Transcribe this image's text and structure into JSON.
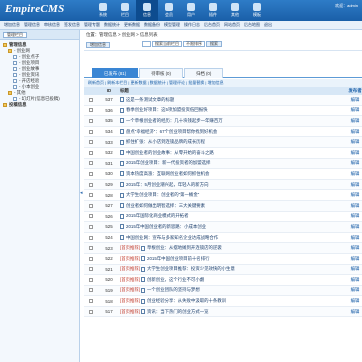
{
  "header": {
    "logo_main": "EmpireCMS",
    "logo_sub": "",
    "nav": [
      "系统",
      "栏目",
      "信息",
      "会员",
      "用户",
      "插件",
      "其他",
      "模板"
    ],
    "active_nav": 2,
    "welcome": "欢迎：admin"
  },
  "subnav": [
    "增加信息",
    "管理信息",
    "审核信息",
    "签发信息",
    "管理专题",
    "数据统计",
    "更新数据",
    "数据备份",
    "模型管理",
    "操作日志",
    "后台首页",
    "网站首页",
    "后台地图",
    "退出"
  ],
  "sidebar": {
    "top_button": "管理栏目",
    "tree": [
      {
        "label": "管理信息",
        "level": 1,
        "folder": true
      },
      {
        "label": "- 创业网",
        "level": 2,
        "folder": true
      },
      {
        "label": "- 创业点子",
        "level": 3,
        "folder": false
      },
      {
        "label": "- 创业项目",
        "level": 3,
        "folder": false
      },
      {
        "label": "- 创业故事",
        "level": 3,
        "folder": false
      },
      {
        "label": "- 创业资讯",
        "level": 3,
        "folder": false
      },
      {
        "label": "- 开店经验",
        "level": 3,
        "folder": false
      },
      {
        "label": "- 小本创业",
        "level": 3,
        "folder": false
      },
      {
        "label": "- 其他",
        "level": 2,
        "folder": true
      },
      {
        "label": "- 幻灯片(信息已投稿)",
        "level": 3,
        "folder": false
      },
      {
        "label": "投稿信息",
        "level": 1,
        "folder": true
      }
    ]
  },
  "main": {
    "breadcrumb": "位置：管理信息 > 创业网 > 信息列表",
    "toolbar_button": "增加信息",
    "search": {
      "select1": "搜索当前栏目",
      "select2": "不限排序",
      "go": "搜索"
    },
    "tabs": [
      "已发布 (81)",
      "待审核 (0)",
      "归档 (0)"
    ],
    "active_tab": 0,
    "filter_text": "刷新首页 | 刷新本栏目 | 更新数据 | 数据统计 | 管理评论 | 批量替换 | 增加信息",
    "columns": [
      "",
      "ID",
      "标题",
      "发布者"
    ],
    "rows": [
      {
        "id": "537",
        "tag": "",
        "title": "这是一条测试文章的标题"
      },
      {
        "id": "536",
        "tag": "",
        "title": "春季创业好项目：这5项加盟投资低回报快"
      },
      {
        "id": "535",
        "tag": "",
        "title": "一个草根创业者的经历：几十块钱起步一年赚百万"
      },
      {
        "id": "534",
        "tag": "",
        "title": "盘点“幸福经济”：67个创业项目帮你找到好机会"
      },
      {
        "id": "533",
        "tag": "",
        "title": "抓住扩张：从小店到连锁品牌的成长历程"
      },
      {
        "id": "532",
        "tag": "",
        "title": "中国创业者的创业故事：从零开始的奋斗之路"
      },
      {
        "id": "531",
        "tag": "",
        "title": "2015年创业项目：新一代投资者的加盟选择"
      },
      {
        "id": "530",
        "tag": "",
        "title": "资本热度高涨：互联网创业者如何抓住机会"
      },
      {
        "id": "529",
        "tag": "",
        "title": "2015年：5月创业潮兴起，年轻人的新方向"
      },
      {
        "id": "528",
        "tag": "",
        "title": "大学生创业项目：创业者的“第一桶金”"
      },
      {
        "id": "527",
        "tag": "",
        "title": "创业者如何做出明智选择：三大关键要素"
      },
      {
        "id": "526",
        "tag": "",
        "title": "2015年国际化商业模式的开拓者"
      },
      {
        "id": "525",
        "tag": "",
        "title": "2015年中国创业者的新思路：小成本创业"
      },
      {
        "id": "524",
        "tag": "",
        "title": "中国创业网：宣布与多家知名企业达成战略合作"
      },
      {
        "id": "523",
        "tag": "[首页推荐]",
        "title": "草根创业：从摆地摊到开连锁店的逆袭"
      },
      {
        "id": "522",
        "tag": "[首页推荐]",
        "title": "2015年中国创业项目前十名排行"
      },
      {
        "id": "521",
        "tag": "[首页推荐]",
        "title": "大学生创业项目推荐：投资少见效快的小生意"
      },
      {
        "id": "520",
        "tag": "[首页推荐]",
        "title": "创新创业，这个行业不可小觑"
      },
      {
        "id": "519",
        "tag": "[首页推荐]",
        "title": "一个创业团队的坚持与梦想"
      },
      {
        "id": "518",
        "tag": "[首页推荐]",
        "title": "创业经验分享：从失败中汲取的十条教训"
      },
      {
        "id": "517",
        "tag": "[首页推荐]",
        "title": "资讯：当下热门的创业方式一览"
      }
    ],
    "row_action": "编辑"
  }
}
